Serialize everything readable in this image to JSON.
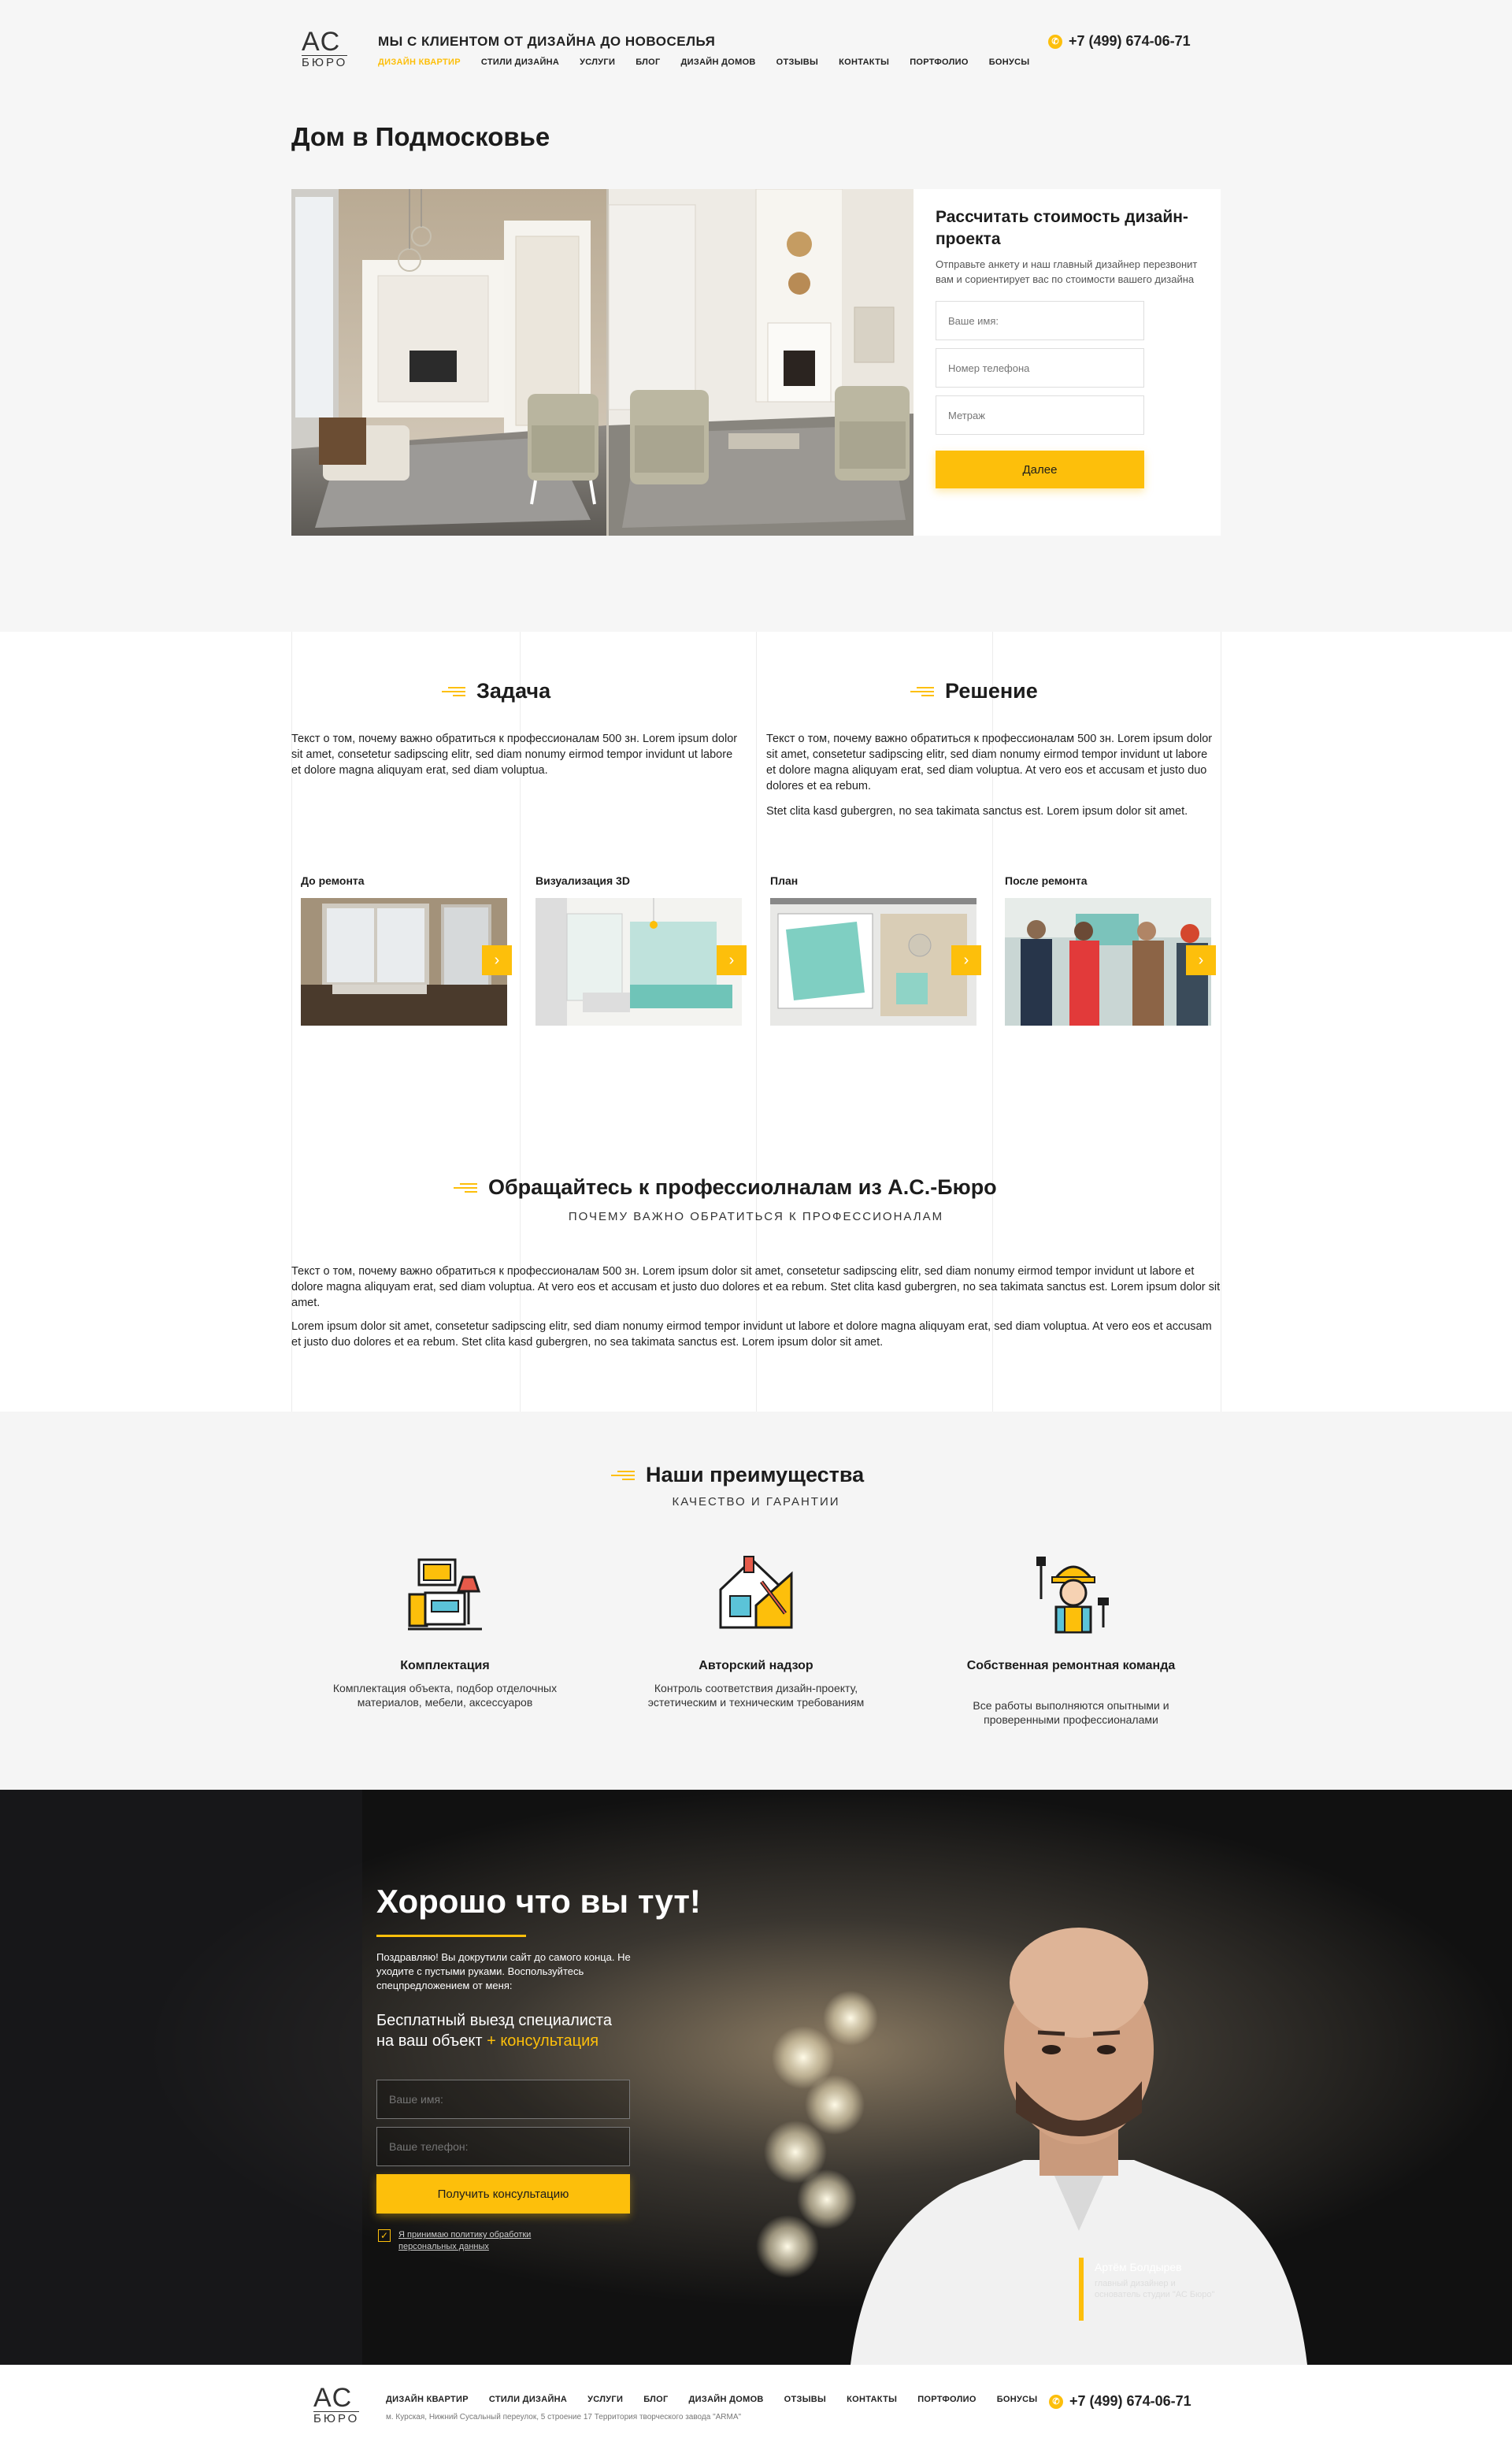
{
  "header": {
    "logo_top": "AC",
    "logo_bottom": "БЮРО",
    "tagline": "МЫ С КЛИЕНТОМ ОТ ДИЗАЙНА ДО НОВОСЕЛЬЯ",
    "phone": "+7 (499) 674-06-71",
    "nav": [
      {
        "label": "ДИЗАЙН КВАРТИР",
        "active": true
      },
      {
        "label": "СТИЛИ ДИЗАЙНА"
      },
      {
        "label": "УСЛУГИ"
      },
      {
        "label": "БЛОГ"
      },
      {
        "label": "ДИЗАЙН ДОМОВ"
      },
      {
        "label": "ОТЗЫВЫ"
      },
      {
        "label": "КОНТАКТЫ"
      },
      {
        "label": "ПОРТФОЛИО"
      },
      {
        "label": "БОНУСЫ"
      }
    ]
  },
  "hero": {
    "title": "Дом в Подмосковье",
    "form": {
      "title": "Рассчитать стоимость дизайн-проекта",
      "text": "Отправьте анкету и наш главный дизайнер перезвонит вам и сориентирует вас по стоимости вашего дизайна",
      "name_placeholder": "Ваше имя:",
      "phone_placeholder": "Номер телефона",
      "area_placeholder": "Метраж",
      "submit": "Далее"
    }
  },
  "task": {
    "title": "Задача",
    "text": "Текст о том, почему важно обратиться к профессионалам 500 зн. Lorem ipsum dolor sit amet, consetetur sadipscing elitr, sed diam nonumy eirmod tempor invidunt ut labore et dolore magna aliquyam erat, sed diam voluptua."
  },
  "solution": {
    "title": "Решение",
    "text1": "Текст о том, почему важно обратиться к профессионалам 500 зн. Lorem ipsum dolor sit amet, consetetur sadipscing elitr, sed diam nonumy eirmod tempor invidunt ut labore et dolore magna aliquyam erat, sed diam voluptua. At vero eos et accusam et justo duo dolores et ea rebum.",
    "text2": "Stet clita kasd gubergren, no sea takimata sanctus est. Lorem ipsum dolor sit amet."
  },
  "stages": [
    {
      "label": "До ремонта"
    },
    {
      "label": "Визуализация 3D"
    },
    {
      "label": "План"
    },
    {
      "label": "После  ремонта"
    }
  ],
  "pros": {
    "title": "Обращайтесь к профессиолналам из А.С.-Бюро",
    "subtitle": "ПОЧЕМУ ВАЖНО ОБРАТИТЬСЯ К ПРОФЕССИОНАЛАМ",
    "p1": "Текст о том, почему важно обратиться к профессионалам 500 зн. Lorem ipsum dolor sit amet, consetetur sadipscing elitr, sed diam nonumy eirmod tempor invidunt ut labore et dolore magna aliquyam erat, sed diam voluptua. At vero eos et accusam et justo duo dolores et ea rebum. Stet clita kasd gubergren, no sea takimata sanctus est. Lorem ipsum dolor sit amet.",
    "p2": "Lorem ipsum dolor sit amet, consetetur sadipscing elitr, sed diam nonumy eirmod tempor invidunt ut labore et dolore magna aliquyam erat, sed diam voluptua. At vero eos et accusam et justo duo dolores et ea rebum. Stet clita kasd gubergren, no sea takimata sanctus est. Lorem ipsum dolor sit amet."
  },
  "advantages": {
    "title": "Наши преимущества",
    "subtitle": "КАЧЕСТВО И ГАРАНТИИ",
    "items": [
      {
        "title": "Комплектация",
        "desc": "Комплектация объекта, подбор отделочных материалов, мебели, аксессуаров",
        "icon": "furniture-icon"
      },
      {
        "title": "Авторский надзор",
        "desc": "Контроль соответствия дизайн-проекту, эстетическим и техническим требованиям",
        "icon": "house-blueprint-icon"
      },
      {
        "title": "Собственная ремонтная команда",
        "desc": "Все работы выполняются опытными и проверенными профессионалами",
        "icon": "builder-icon"
      }
    ]
  },
  "promo": {
    "title": "Хорошо что вы тут!",
    "small": "Поздравляю! Вы докрутили сайт до самого конца. Не уходите с пустыми руками. Воспользуйтесь спецпредложением от меня:",
    "offer_line1": "Бесплатный выезд специалиста",
    "offer_line2": "на ваш объект",
    "offer_accent": "+ консультация",
    "name_placeholder": "Ваше имя:",
    "phone_placeholder": "Ваше телефон:",
    "submit": "Получить консультацию",
    "consent": "Я принимаю политику обработки персональных данных",
    "person_name": "Артём Болдырев",
    "person_role": "главный дизайнер и основатель студии \"АС Бюро\""
  },
  "footer": {
    "logo_top": "AC",
    "logo_bottom": "БЮРО",
    "address": "м. Курская, Нижний Сусальный переулок, 5 строение 17   Территория творческого завода \"ARMA\"",
    "phone": "+7 (499) 674-06-71",
    "nav": [
      "ДИЗАЙН КВАРТИР",
      "СТИЛИ ДИЗАЙНА",
      "УСЛУГИ",
      "БЛОГ",
      "ДИЗАЙН ДОМОВ",
      "ОТЗЫВЫ",
      "КОНТАКТЫ",
      "ПОРТФОЛИО",
      "БОНУСЫ"
    ]
  },
  "colors": {
    "accent": "#fdbf0b",
    "dark": "#1c1c1c",
    "light_bg": "#f6f6f6"
  }
}
